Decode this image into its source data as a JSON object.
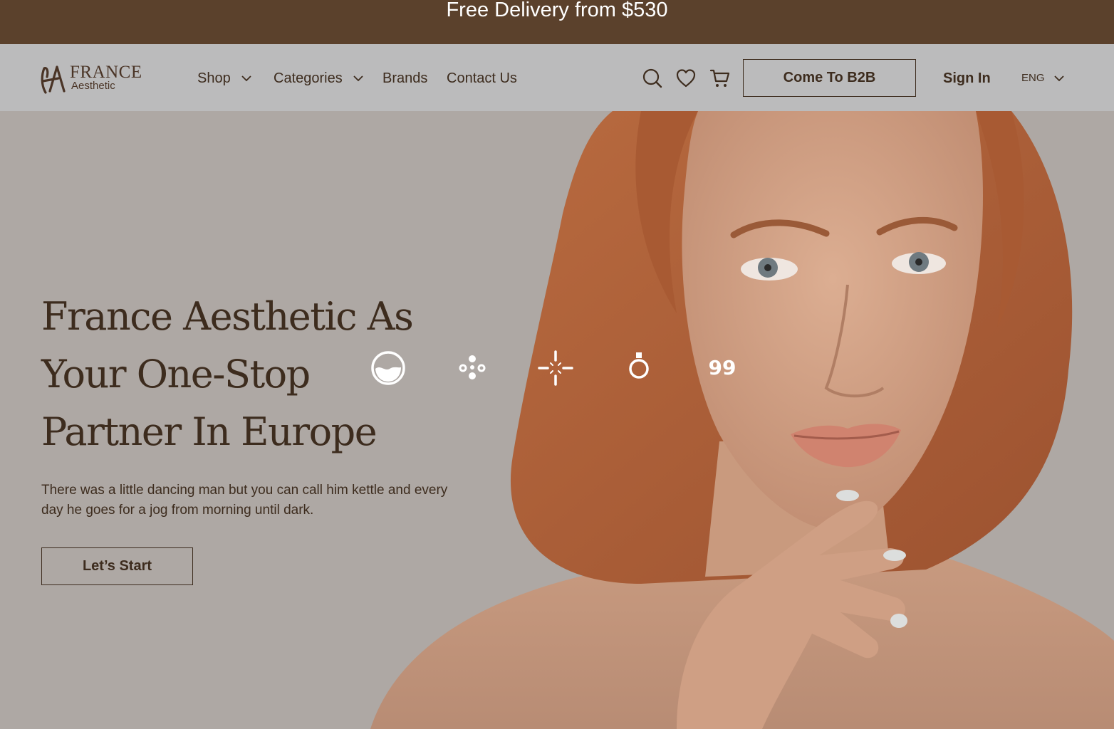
{
  "promo": {
    "text": "Free Delivery from $530"
  },
  "brand": {
    "name": "FRANCE",
    "tagline": "Aesthetic"
  },
  "nav": {
    "items": [
      {
        "label": "Shop",
        "has_dropdown": true
      },
      {
        "label": "Categories",
        "has_dropdown": true
      },
      {
        "label": "Brands",
        "has_dropdown": false
      },
      {
        "label": "Contact Us",
        "has_dropdown": false
      }
    ],
    "icons": [
      "search-icon",
      "heart-icon",
      "cart-icon"
    ],
    "b2b_label": "Come To B2B",
    "signin_label": "Sign In",
    "language": "ENG"
  },
  "hero": {
    "title_lines": [
      "France Aesthetic As",
      "Your One-Stop",
      "Partner In Europe"
    ],
    "description": "There was a little dancing man but you can call him kettle and every day he goes for a jog from morning until dark.",
    "cta_label": "Let’s Start",
    "feature_icons": [
      "water-drop-circle-icon",
      "dots-cluster-icon",
      "sparkle-burst-icon",
      "ring-icon",
      "quote-99-icon"
    ]
  },
  "colors": {
    "promo_bg": "#5b412c",
    "nav_bg": "#bbbbbc",
    "hero_bg": "#aea8a4",
    "text_dark": "#3d2c1e",
    "hair": "#b8663a",
    "skin": "#d8a88c"
  }
}
